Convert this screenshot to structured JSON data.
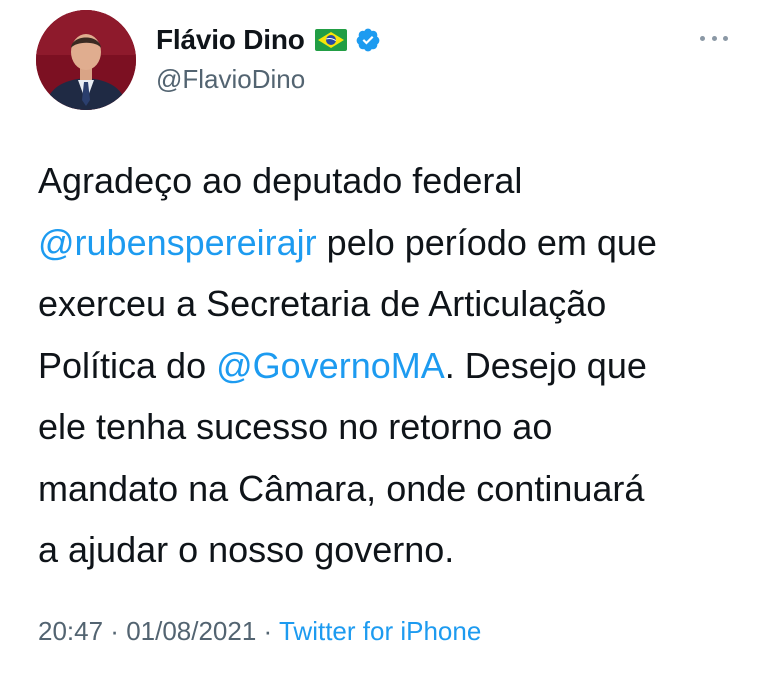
{
  "author": {
    "display_name": "Flávio Dino",
    "handle": "@FlavioDino",
    "flag_icon": "brazil-flag-icon",
    "verified_icon": "verified-badge-icon",
    "verified_color": "#1d9bf0"
  },
  "tweet": {
    "line1": "Agradeço ao deputado federal",
    "mention1": "@rubenspereirajr",
    "line2_rest": " pelo período em que",
    "line3": "exerceu a Secretaria de Articulação",
    "line4_start": "Política do ",
    "mention2": "@GovernoMA",
    "line4_rest": ". Desejo que",
    "line5": "ele tenha sucesso no retorno ao",
    "line6": "mandato na Câmara, onde continuará",
    "line7": "a ajudar o nosso governo."
  },
  "meta": {
    "time": "20:47",
    "separator": " · ",
    "date": "01/08/2021",
    "separator2": " · ",
    "source": "Twitter for iPhone"
  },
  "colors": {
    "link": "#1d9bf0",
    "secondary_text": "#536471",
    "primary_text": "#0f1419"
  },
  "icons": {
    "more": "more-horizontal-icon"
  }
}
